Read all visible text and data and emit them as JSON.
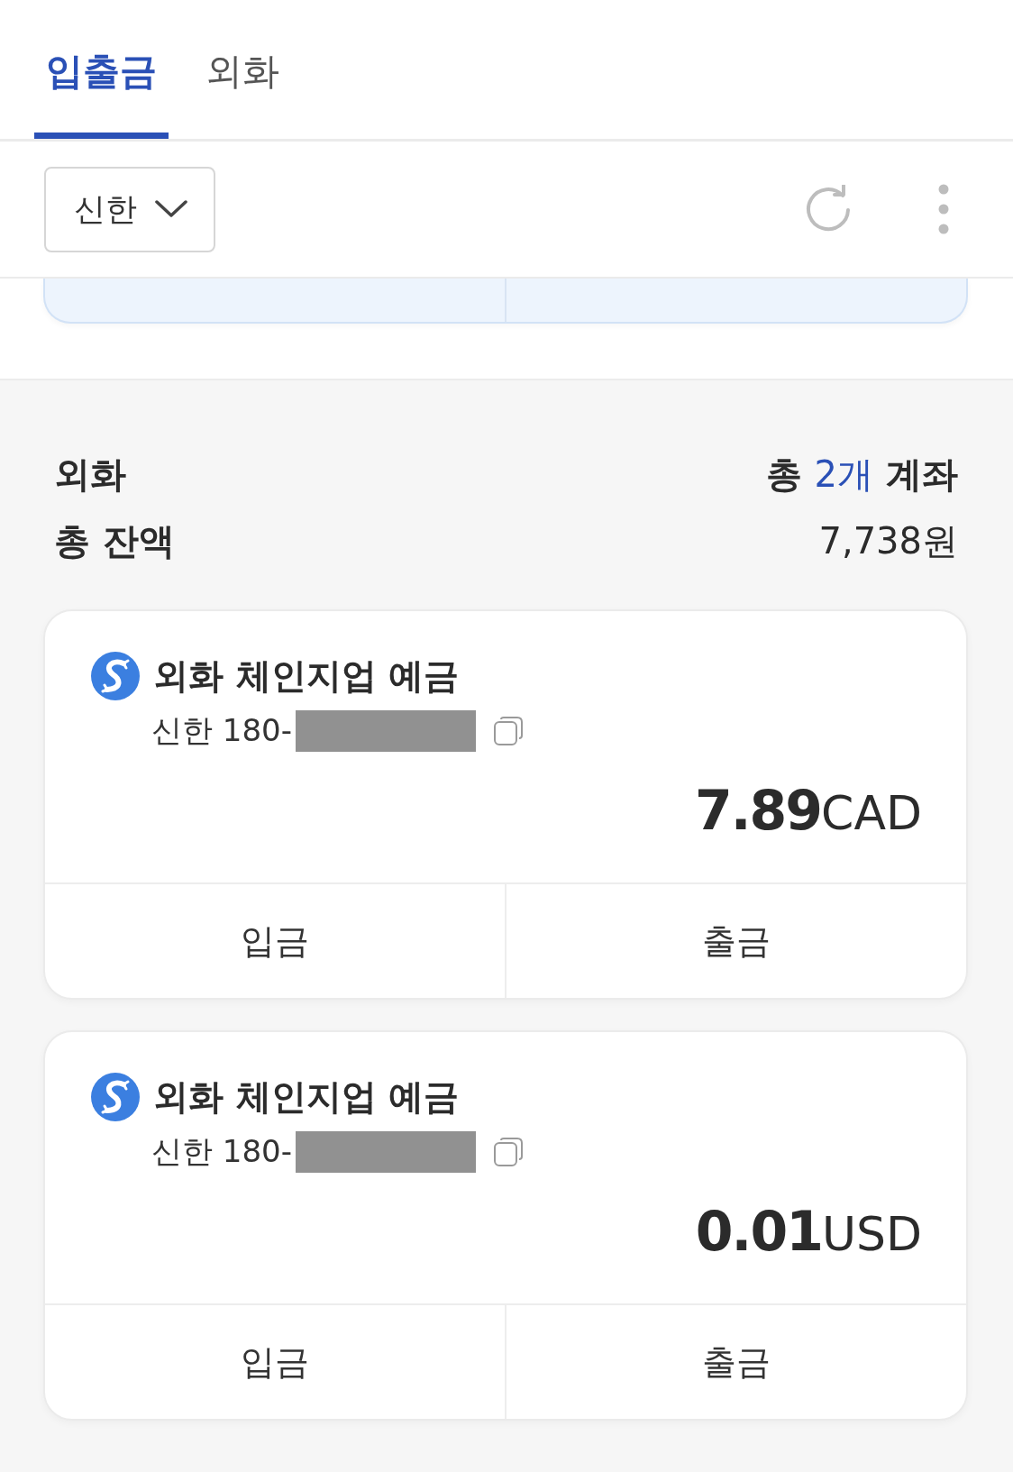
{
  "tabs": [
    {
      "label": "입출금",
      "selected": true
    },
    {
      "label": "외화",
      "selected": false
    }
  ],
  "toolbar": {
    "bank_filter": "신한"
  },
  "section": {
    "title": "외화",
    "account_count": {
      "before": "총 ",
      "count": "2개",
      "after": " 계좌"
    },
    "balance_label": "총 잔액",
    "balance": "7,738원"
  },
  "accounts": [
    {
      "product": "외화 체인지업 예금",
      "account_number": "신한 180-",
      "amount": "7.89",
      "currency": "CAD",
      "actions": [
        "입금",
        "출금"
      ]
    },
    {
      "product": "외화 체인지업 예금",
      "account_number": "신한 180-",
      "amount": "0.01",
      "currency": "USD",
      "actions": [
        "입금",
        "출금"
      ]
    }
  ]
}
